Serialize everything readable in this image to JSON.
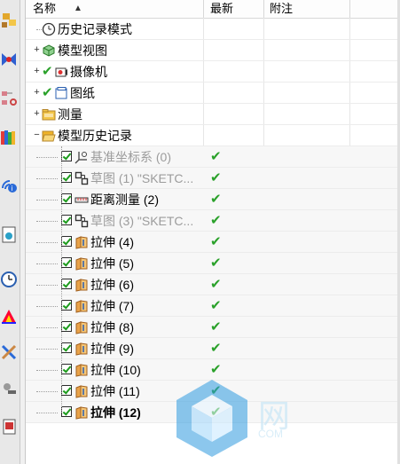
{
  "header": {
    "col_name": "名称",
    "col_latest": "最新",
    "col_note": "附注",
    "sort_icon": "sort-ascending-icon"
  },
  "left_toolbar": {
    "icons": [
      "assembly-navigator-icon",
      "constraint-navigator-icon",
      "part-navigator-icon",
      "reuse-library-icon",
      "hd3d-tools-icon",
      "web-browser-icon",
      "history-icon",
      "system-materials-icon",
      "process-studio-icon",
      "manufacturing-wizard-icon",
      "roles-icon"
    ]
  },
  "tree": {
    "items": [
      {
        "label": "历史记录模式",
        "icon": "clock-icon",
        "level": 0,
        "expander": "",
        "checked": null,
        "latest": false,
        "style": "normal"
      },
      {
        "label": "模型视图",
        "icon": "model-views-icon",
        "level": 0,
        "expander": "+",
        "checked": null,
        "latest": false,
        "style": "normal"
      },
      {
        "label": "摄像机",
        "icon": "camera-icon",
        "level": 0,
        "expander": "+",
        "checked": "green",
        "latest": false,
        "style": "normal"
      },
      {
        "label": "图纸",
        "icon": "drawing-icon",
        "level": 0,
        "expander": "+",
        "checked": "green",
        "latest": false,
        "style": "normal"
      },
      {
        "label": "测量",
        "icon": "folder-icon",
        "level": 0,
        "expander": "+",
        "checked": null,
        "latest": false,
        "style": "normal"
      },
      {
        "label": "模型历史记录",
        "icon": "open-folder-icon",
        "level": 0,
        "expander": "−",
        "checked": null,
        "latest": false,
        "style": "normal"
      },
      {
        "label": "基准坐标系 (0)",
        "icon": "datum-csys-icon",
        "level": 1,
        "checked": "box",
        "latest": true,
        "style": "gray"
      },
      {
        "label": "草图 (1) \"SKETC...",
        "icon": "sketch-icon",
        "level": 1,
        "checked": "box",
        "latest": true,
        "style": "gray"
      },
      {
        "label": "距离测量 (2)",
        "icon": "measure-distance-icon",
        "level": 1,
        "checked": "box",
        "latest": true,
        "style": "normal"
      },
      {
        "label": "草图 (3) \"SKETC...",
        "icon": "sketch-icon",
        "level": 1,
        "checked": "box",
        "latest": true,
        "style": "gray"
      },
      {
        "label": "拉伸 (4)",
        "icon": "extrude-icon",
        "level": 1,
        "checked": "box",
        "latest": true,
        "style": "normal"
      },
      {
        "label": "拉伸 (5)",
        "icon": "extrude-icon",
        "level": 1,
        "checked": "box",
        "latest": true,
        "style": "normal"
      },
      {
        "label": "拉伸 (6)",
        "icon": "extrude-icon",
        "level": 1,
        "checked": "box",
        "latest": true,
        "style": "normal"
      },
      {
        "label": "拉伸 (7)",
        "icon": "extrude-icon",
        "level": 1,
        "checked": "box",
        "latest": true,
        "style": "normal"
      },
      {
        "label": "拉伸 (8)",
        "icon": "extrude-icon",
        "level": 1,
        "checked": "box",
        "latest": true,
        "style": "normal"
      },
      {
        "label": "拉伸 (9)",
        "icon": "extrude-icon",
        "level": 1,
        "checked": "box",
        "latest": true,
        "style": "normal"
      },
      {
        "label": "拉伸 (10)",
        "icon": "extrude-icon",
        "level": 1,
        "checked": "box",
        "latest": true,
        "style": "normal"
      },
      {
        "label": "拉伸 (11)",
        "icon": "extrude-icon",
        "level": 1,
        "checked": "box",
        "latest": true,
        "style": "normal"
      },
      {
        "label": "拉伸 (12)",
        "icon": "extrude-icon",
        "level": 1,
        "checked": "box",
        "latest": true,
        "style": "bold"
      }
    ],
    "latest_mark": "✔"
  },
  "watermark": {
    "text": "网",
    "url": "COM"
  }
}
